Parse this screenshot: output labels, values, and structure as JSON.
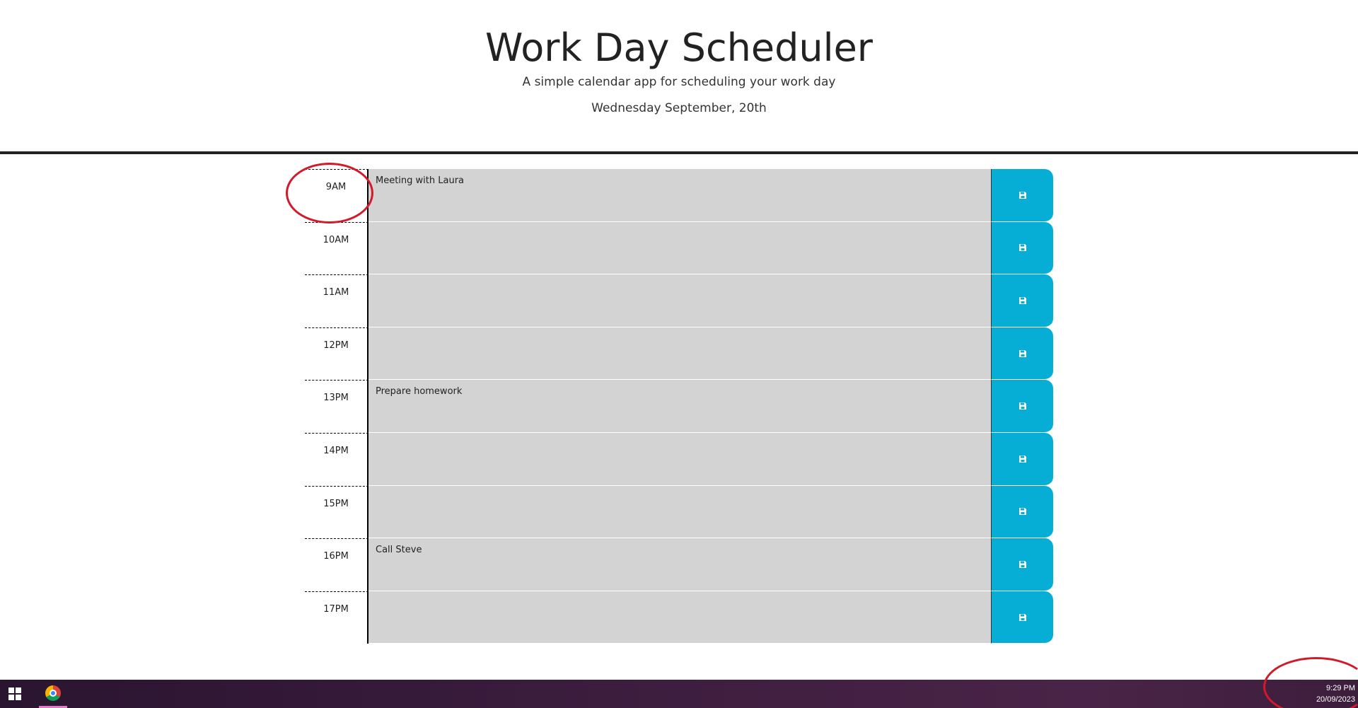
{
  "header": {
    "title": "Work Day Scheduler",
    "lead": "A simple calendar app for scheduling your work day",
    "current_day": "Wednesday September, 20th"
  },
  "schedule": {
    "rows": [
      {
        "hour": "9AM",
        "text": "Meeting with Laura"
      },
      {
        "hour": "10AM",
        "text": ""
      },
      {
        "hour": "11AM",
        "text": ""
      },
      {
        "hour": "12PM",
        "text": ""
      },
      {
        "hour": "13PM",
        "text": "Prepare homework"
      },
      {
        "hour": "14PM",
        "text": ""
      },
      {
        "hour": "15PM",
        "text": ""
      },
      {
        "hour": "16PM",
        "text": "Call Steve"
      },
      {
        "hour": "17PM",
        "text": ""
      }
    ],
    "save_icon": "floppy-disk-icon",
    "colors": {
      "row_bg": "#d3d3d3",
      "save_bg": "#06aed5"
    }
  },
  "taskbar": {
    "apps": [
      {
        "icon": "windows-start-icon"
      },
      {
        "icon": "chrome-icon"
      }
    ],
    "clock": {
      "time": "9:29 PM",
      "date": "20/09/2023"
    }
  }
}
